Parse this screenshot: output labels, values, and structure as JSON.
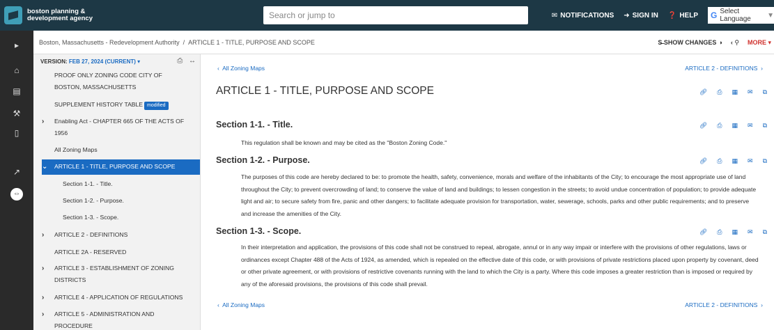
{
  "header": {
    "logo_line1": "boston planning &",
    "logo_line2": "development agency",
    "search_placeholder": "Search or jump to",
    "notifications": "NOTIFICATIONS",
    "sign_in": "SIGN IN",
    "help": "HELP",
    "language": "Select Language"
  },
  "breadcrumb": {
    "root": "Boston, Massachusetts - Redevelopment Authority",
    "sep": "/",
    "current": "ARTICLE 1 - TITLE, PURPOSE AND SCOPE",
    "show_changes": "SHOW CHANGES",
    "more": "MORE"
  },
  "sidebar": {
    "version_label": "VERSION:",
    "version_value": "FEB 27, 2024 (CURRENT)",
    "items": [
      {
        "label": "PROOF ONLY ZONING CODE CITY OF"
      },
      {
        "label": "BOSTON, MASSACHUSETTS"
      },
      {
        "label": "SUPPLEMENT HISTORY TABLE",
        "badge": "modified"
      },
      {
        "label": "Enabling Act - CHAPTER 665 OF THE ACTS OF"
      },
      {
        "label": "1956"
      },
      {
        "label": "All Zoning Maps"
      },
      {
        "label": "ARTICLE 1 - TITLE, PURPOSE AND SCOPE"
      },
      {
        "label": "Section 1-1. - Title."
      },
      {
        "label": "Section 1-2. - Purpose."
      },
      {
        "label": "Section 1-3. - Scope."
      },
      {
        "label": "ARTICLE 2 - DEFINITIONS"
      },
      {
        "label": "ARTICLE 2A - RESERVED"
      },
      {
        "label": "ARTICLE 3 - ESTABLISHMENT OF ZONING"
      },
      {
        "label": "DISTRICTS"
      },
      {
        "label": "ARTICLE 4 - APPLICATION OF REGULATIONS"
      },
      {
        "label": "ARTICLE 5 - ADMINISTRATION AND"
      },
      {
        "label": "PROCEDURE"
      }
    ]
  },
  "main": {
    "prev_link": "All Zoning Maps",
    "next_link": "ARTICLE 2 - DEFINITIONS",
    "article_title": "ARTICLE 1 - TITLE, PURPOSE AND SCOPE",
    "sections": [
      {
        "title": "Section 1-1. - Title.",
        "text": "This regulation shall be known and may be cited as the \"Boston Zoning Code.\""
      },
      {
        "title": "Section 1-2. - Purpose.",
        "text": "The purposes of this code are hereby declared to be: to promote the health, safety, convenience, morals and welfare of the inhabitants of the City; to encourage the most appropriate use of land throughout the City; to prevent overcrowding of land; to conserve the value of land and buildings; to lessen congestion in the streets; to avoid undue concentration of population; to provide adequate light and air; to secure safety from fire, panic and other dangers; to facilitate adequate provision for transportation, water, sewerage, schools, parks and other public requirements; and to preserve and increase the amenities of the City."
      },
      {
        "title": "Section 1-3. - Scope.",
        "text": "In their interpretation and application, the provisions of this code shall not be construed to repeal, abrogate, annul or in any way impair or interfere with the provisions of other regulations, laws or ordinances except Chapter 488 of the Acts of 1924, as amended, which is repealed on the effective date of this code, or with provisions of private restrictions placed upon property by covenant, deed or other private agreement, or with provisions of restrictive covenants running with the land to which the City is a party. Where this code imposes a greater restriction than is imposed or required by any of the aforesaid provisions, the provisions of this code shall prevail."
      }
    ]
  },
  "colors": {
    "header_bg": "#1d3845",
    "accent": "#1a6bc2",
    "more": "#d0312d"
  }
}
